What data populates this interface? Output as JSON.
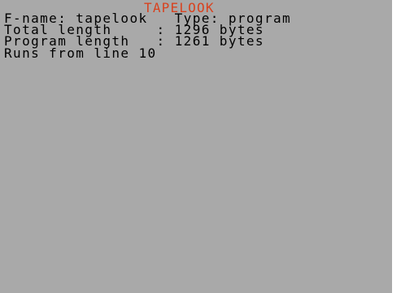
{
  "screen": {
    "title": "TAPELOOK",
    "title_color": "#d8421f",
    "background_color": "#a9a9a9",
    "text_color": "#000000",
    "lines": [
      "F-name: tapelook   Type: program",
      "Total length     : 1296 bytes",
      "Program length   : 1261 bytes",
      "Runs from line 10"
    ]
  }
}
